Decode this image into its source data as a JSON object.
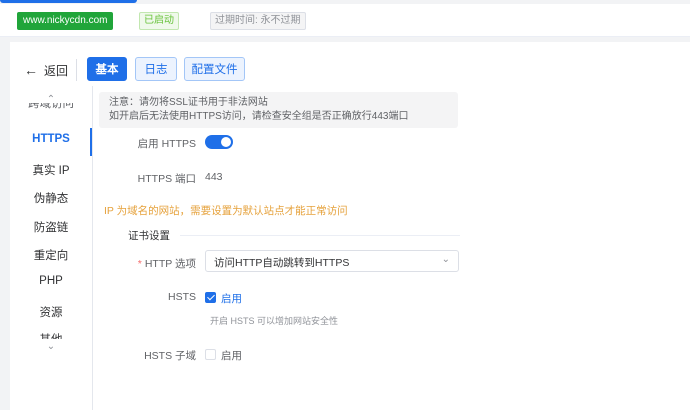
{
  "site": {
    "domain": "www.nickycdn.com",
    "status": "已启动",
    "expire": "过期时间: 永不过期"
  },
  "header": {
    "back_label": "返回",
    "tabs": [
      {
        "label": "基本",
        "active": true
      },
      {
        "label": "日志",
        "active": false
      },
      {
        "label": "配置文件",
        "active": false
      }
    ]
  },
  "sidebar": {
    "partial_top": "跨域访问",
    "items": [
      {
        "label": "HTTPS",
        "active": true
      },
      {
        "label": "真实 IP"
      },
      {
        "label": "伪静态"
      },
      {
        "label": "防盗链"
      },
      {
        "label": "重定向"
      },
      {
        "label": "PHP"
      },
      {
        "label": "资源"
      },
      {
        "label": "其他"
      }
    ],
    "scroll_up_icon": "chevron-up-icon",
    "scroll_down_icon": "chevron-down-icon"
  },
  "notice": {
    "line1": "注意：请勿将SSL证书用于非法网站",
    "line2": "如开启后无法使用HTTPS访问，请检查安全组是否正确放行443端口"
  },
  "form": {
    "enable_https_label": "启用 HTTPS",
    "enable_https_on": true,
    "https_port_label": "HTTPS 端口",
    "https_port_value": "443",
    "warning": "IP 为域名的网站，需要设置为默认站点才能正常访问",
    "cert_section": "证书设置",
    "http_option_label": "HTTP 选项",
    "http_option_required": "*",
    "http_option_value": "访问HTTP自动跳转到HTTPS",
    "hsts_label": "HSTS",
    "hsts_checkbox_label": "启用",
    "hsts_checked": true,
    "hsts_hint": "开启 HSTS 可以增加网站安全性",
    "hsts_sub_label": "HSTS 子域",
    "hsts_sub_checkbox_label": "启用",
    "hsts_sub_checked": false
  },
  "colors": {
    "primary": "#1f6fe8",
    "success": "#20a53a",
    "warning": "#e6a23c"
  }
}
